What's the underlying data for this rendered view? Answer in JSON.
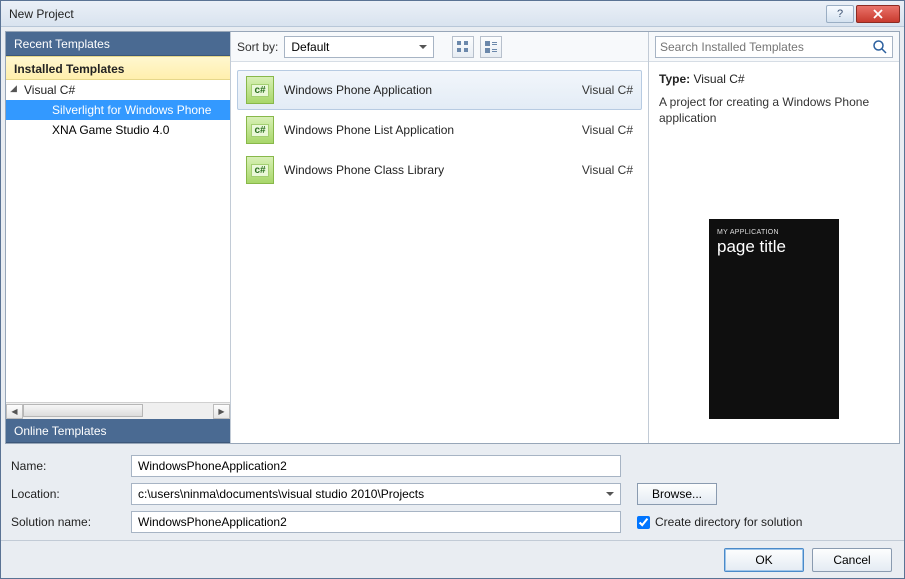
{
  "window": {
    "title": "New Project"
  },
  "sidebar": {
    "recent": "Recent Templates",
    "installed": "Installed Templates",
    "online": "Online Templates",
    "tree": {
      "root": "Visual C#",
      "items": [
        {
          "label": "Silverlight for Windows Phone",
          "selected": true
        },
        {
          "label": "XNA Game Studio 4.0",
          "selected": false
        }
      ]
    }
  },
  "toolbar": {
    "sort_label": "Sort by:",
    "sort_value": "Default"
  },
  "templates": [
    {
      "name": "Windows Phone Application",
      "lang": "Visual C#",
      "selected": true
    },
    {
      "name": "Windows Phone List Application",
      "lang": "Visual C#",
      "selected": false
    },
    {
      "name": "Windows Phone Class Library",
      "lang": "Visual C#",
      "selected": false
    }
  ],
  "search": {
    "placeholder": "Search Installed Templates"
  },
  "info": {
    "type_label": "Type:",
    "type_value": "Visual C#",
    "description": "A project for creating a Windows Phone application",
    "preview_app": "MY APPLICATION",
    "preview_title": "page title"
  },
  "form": {
    "name_label": "Name:",
    "name_value": "WindowsPhoneApplication2",
    "location_label": "Location:",
    "location_value": "c:\\users\\ninma\\documents\\visual studio 2010\\Projects",
    "solution_label": "Solution name:",
    "solution_value": "WindowsPhoneApplication2",
    "browse": "Browse...",
    "create_dir": "Create directory for solution",
    "create_dir_checked": true
  },
  "buttons": {
    "ok": "OK",
    "cancel": "Cancel"
  }
}
